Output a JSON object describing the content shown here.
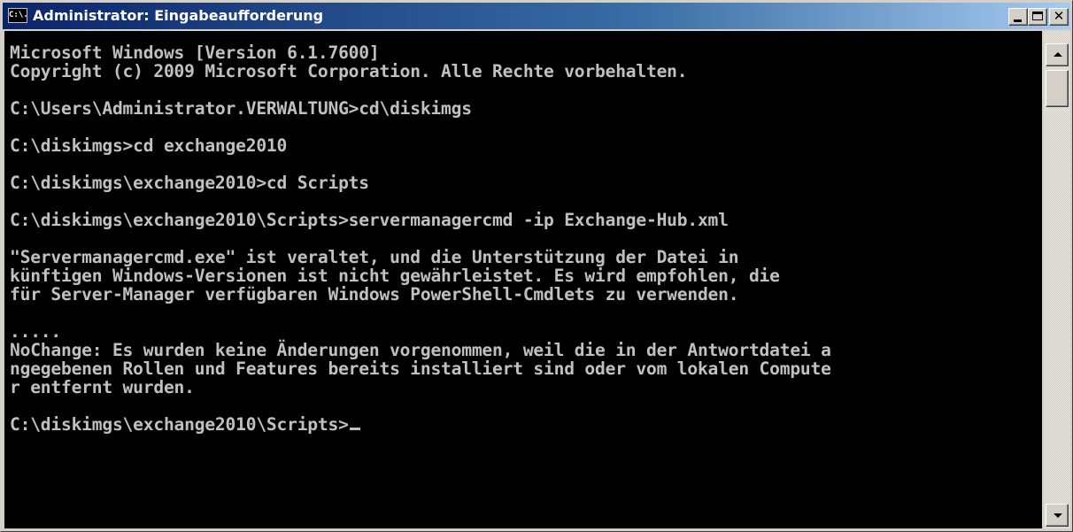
{
  "window": {
    "title": "Administrator: Eingabeaufforderung",
    "icon_text": "C:\\.",
    "colors": {
      "titlebar_start": "#0a246a",
      "titlebar_end": "#a6caf0",
      "console_bg": "#000000",
      "console_fg": "#c0c0c0",
      "chrome": "#d4d0c8"
    }
  },
  "titlebar_buttons": {
    "minimize_icon": "minimize-icon",
    "maximize_icon": "maximize-icon",
    "close_icon": "close-icon",
    "close_glyph": "✕"
  },
  "console": {
    "lines": [
      "Microsoft Windows [Version 6.1.7600]",
      "Copyright (c) 2009 Microsoft Corporation. Alle Rechte vorbehalten.",
      "",
      "C:\\Users\\Administrator.VERWALTUNG>cd\\diskimgs",
      "",
      "C:\\diskimgs>cd exchange2010",
      "",
      "C:\\diskimgs\\exchange2010>cd Scripts",
      "",
      "C:\\diskimgs\\exchange2010\\Scripts>servermanagercmd -ip Exchange-Hub.xml",
      "",
      "\"Servermanagercmd.exe\" ist veraltet, und die Unterstützung der Datei in",
      "künftigen Windows-Versionen ist nicht gewährleistet. Es wird empfohlen, die",
      "für Server-Manager verfügbaren Windows PowerShell-Cmdlets zu verwenden.",
      "",
      ".....",
      "NoChange: Es wurden keine Änderungen vorgenommen, weil die in der Antwortdatei a",
      "ngegebenen Rollen und Features bereits installiert sind oder vom lokalen Compute",
      "r entfernt wurden.",
      ""
    ],
    "prompt": "C:\\diskimgs\\exchange2010\\Scripts>"
  },
  "scrollbar": {
    "up_icon": "scroll-up-arrow-icon",
    "down_icon": "scroll-down-arrow-icon"
  }
}
